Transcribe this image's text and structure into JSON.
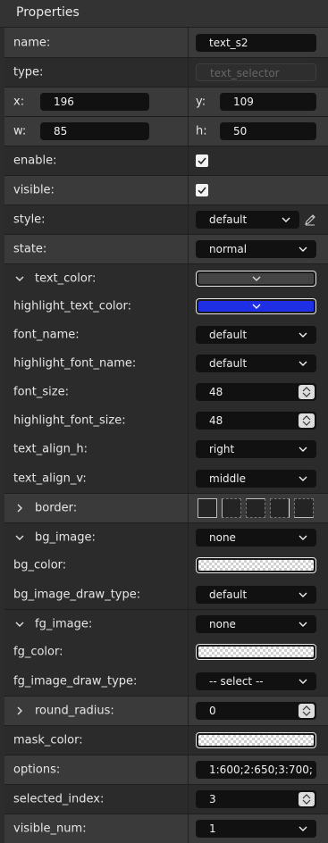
{
  "panel": {
    "title": "Properties"
  },
  "props": {
    "name": {
      "label": "name:",
      "value": "text_s2"
    },
    "type": {
      "label": "type:",
      "value": "text_selector"
    },
    "x": {
      "label": "x:",
      "value": "196"
    },
    "y": {
      "label": "y:",
      "value": "109"
    },
    "w": {
      "label": "w:",
      "value": "85"
    },
    "h": {
      "label": "h:",
      "value": "50"
    },
    "enable": {
      "label": "enable:",
      "checked": true
    },
    "visible": {
      "label": "visible:",
      "checked": true
    },
    "style": {
      "label": "style:",
      "value": "default"
    },
    "state": {
      "label": "state:",
      "value": "normal"
    },
    "text_color": {
      "label": "text_color:",
      "color": "#3a3a3a"
    },
    "highlight_text_color": {
      "label": "highlight_text_color:",
      "color": "#1f2fe6"
    },
    "font_name": {
      "label": "font_name:",
      "value": "default"
    },
    "highlight_font_name": {
      "label": "highlight_font_name:",
      "value": "default"
    },
    "font_size": {
      "label": "font_size:",
      "value": "48"
    },
    "highlight_font_size": {
      "label": "highlight_font_size:",
      "value": "48"
    },
    "text_align_h": {
      "label": "text_align_h:",
      "value": "right"
    },
    "text_align_v": {
      "label": "text_align_v:",
      "value": "middle"
    },
    "border": {
      "label": "border:"
    },
    "bg_image": {
      "label": "bg_image:",
      "value": "none"
    },
    "bg_color": {
      "label": "bg_color:"
    },
    "bg_image_draw_type": {
      "label": "bg_image_draw_type:",
      "value": "default"
    },
    "fg_image": {
      "label": "fg_image:",
      "value": "none"
    },
    "fg_color": {
      "label": "fg_color:"
    },
    "fg_image_draw_type": {
      "label": "fg_image_draw_type:",
      "value": "-- select --"
    },
    "round_radius": {
      "label": "round_radius:",
      "value": "0"
    },
    "mask_color": {
      "label": "mask_color:"
    },
    "options": {
      "label": "options:",
      "value": "1:600;2:650;3:700;"
    },
    "selected_index": {
      "label": "selected_index:",
      "value": "3"
    },
    "visible_num": {
      "label": "visible_num:",
      "value": "1"
    }
  },
  "colors": {
    "panel_bg": "#2b2b2b",
    "band_bg": "#3a3a3a",
    "field_bg": "#111111"
  }
}
